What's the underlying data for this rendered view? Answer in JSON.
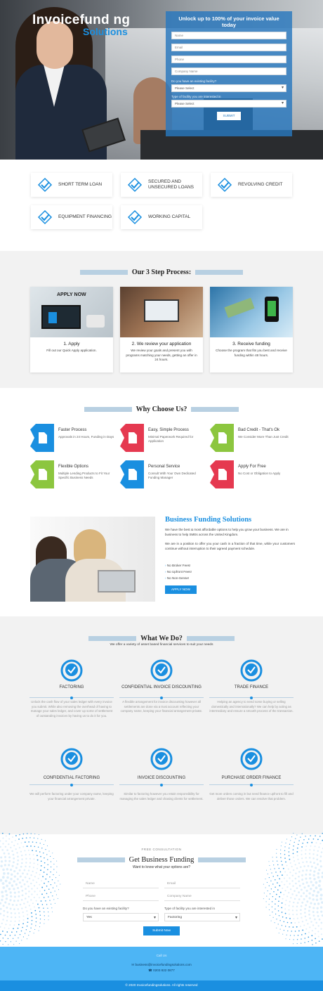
{
  "hero": {
    "logo_line1": "Invoicefund ng",
    "logo_line2": "Solutions",
    "form_title": "Unlock up to 100% of your invoice value today",
    "fields": [
      "Name",
      "Email",
      "Phone",
      "Company Name"
    ],
    "q1_label": "Do you have an existing facility?",
    "q1_value": "Please Select",
    "q2_label": "Type of facility you are interested in",
    "q2_value": "Please Select",
    "submit": "SUBMIT"
  },
  "services": [
    "SHORT TERM LOAN",
    "SECURED AND UNSECURED LOANS",
    "REVOLVING CREDIT",
    "EQUIPMENT FINANCING",
    "WORKING CAPITAL"
  ],
  "steps": {
    "heading": "Our 3 Step Process:",
    "apply_now_img_text": "APPLY NOW",
    "items": [
      {
        "title": "1. Apply",
        "desc": "Fill out our Quick Apply application."
      },
      {
        "title": "2. We review your application",
        "desc": "We review your goals and present you with programs matching your needs, getting an offer in 24 hours."
      },
      {
        "title": "3. Receive funding",
        "desc": "Choose the program that fits you best and receive funding within 48 hours."
      }
    ]
  },
  "why": {
    "heading": "Why Choose Us?",
    "items": [
      {
        "title": "Faster Process",
        "desc": "Approvals in 24 Hours, Funding in Days",
        "color": "#1a8fe0"
      },
      {
        "title": "Easy, Simple Process",
        "desc": "Minimal Paperwork Required for Application",
        "color": "#e53950"
      },
      {
        "title": "Bad Credit - That's Ok",
        "desc": "We Consider More Than Just Credit",
        "color": "#8cc63f"
      },
      {
        "title": "Flexible Options",
        "desc": "Multiple Lending Products to Fit Your Specific Business Needs",
        "color": "#8cc63f"
      },
      {
        "title": "Personal Service",
        "desc": "Consult With Your Own Dedicated Funding Manager",
        "color": "#1a8fe0"
      },
      {
        "title": "Apply For Free",
        "desc": "No Cost or Obligation to Apply",
        "color": "#e53950"
      }
    ]
  },
  "bfs": {
    "title": "Business Funding Solutions",
    "p1": "We have the best & most affordable options to help you grow your business. We are in business to help SMEs across the United Kingdom.",
    "p2": "We are in a position to offer you your cash in a fraction of that time, while your customers continue without interruption to their agreed payment schedule.",
    "list": [
      "No Broker Fees!",
      "No Upfront Fees!",
      "No Non-Sense!"
    ],
    "button": "APPLY NOW"
  },
  "wwd": {
    "heading": "What We Do?",
    "sub": "We offer a variety of asset based financial services to suit your needs",
    "items": [
      {
        "title": "FACTORING",
        "desc": "Unlock the cash flow of your sales ledger with every invoice you submit. While also removing the overhead of having to manage your sales ledger, and cover up some of settlement of outstanding invoices by having us to do it for you."
      },
      {
        "title": "CONFIDENTIAL INVOICE DISCOUNTING",
        "desc": "A flexible arrangement for invoice discounting however all settlements are done via a trust account reflecting your company name, keeping your financial arrangement private."
      },
      {
        "title": "TRADE FINANCE",
        "desc": "Helping an agency to need some buying or selling domestically and internationally? We can help by acting as intermediary and ensure a smooth process of the transaction."
      },
      {
        "title": "CONFIDENTIAL FACTORING",
        "desc": "We will perform factoring under your company name, keeping your financial arrangement private."
      },
      {
        "title": "INVOICE DISCOUNTING",
        "desc": "Similar to factoring however you retain responsibility for managing the sales ledger and chasing clients for settlement."
      },
      {
        "title": "PURCHASE ORDER FINANCE",
        "desc": "Get more orders coming in but need finance upfront to fill and deliver those orders. We can resolve that problem."
      }
    ]
  },
  "bottom_form": {
    "eyebrow": "FREE CONSULTATION",
    "title": "Get Business Funding",
    "sub": "Want to know what your options are?",
    "name": "Name",
    "email": "Email",
    "phone": "Phone",
    "company": "Company Name",
    "q1_label": "Do you have an existing facility?",
    "q1_value": "Yes",
    "q2_label": "Type of facility you are interested in",
    "q2_value": "Factoring",
    "submit": "Submit Now"
  },
  "footer": {
    "heading": "Call Us",
    "email": "business@invoicefundingsolutions.com",
    "phone": "0203 822 0877",
    "copyright": "2020 Invoicefundingsolutions. All rights reserved"
  }
}
